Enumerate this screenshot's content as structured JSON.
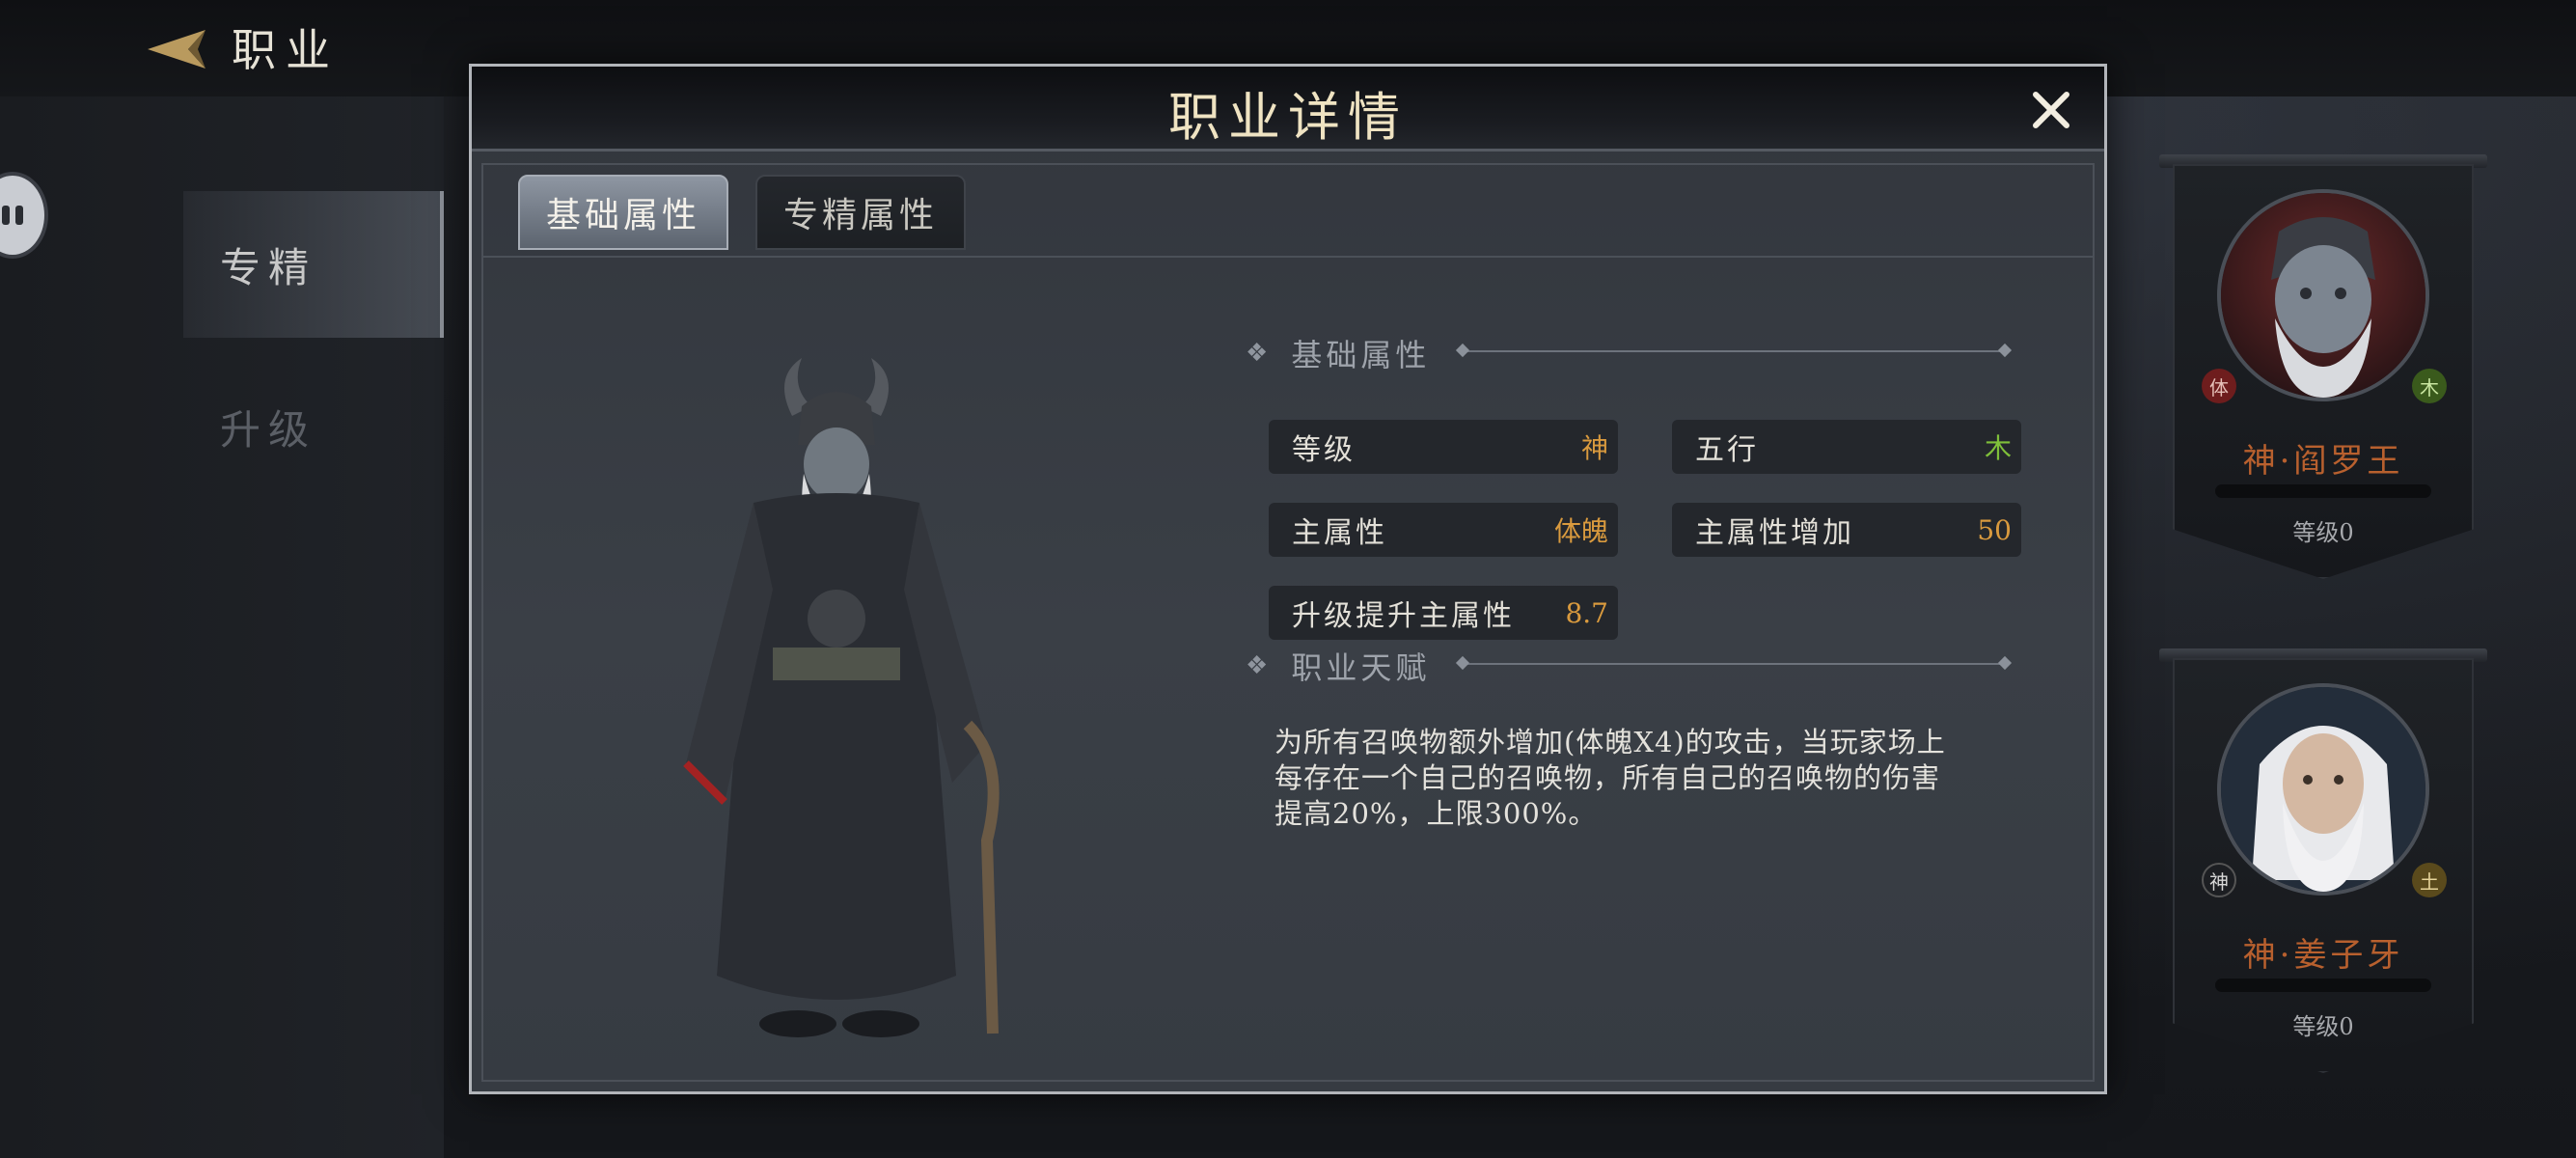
{
  "header": {
    "title": "职业"
  },
  "sidebar": {
    "items": [
      {
        "label": "专精"
      },
      {
        "label": "升级"
      }
    ]
  },
  "modal": {
    "title": "职业详情",
    "tabs": [
      {
        "label": "基础属性"
      },
      {
        "label": "专精属性"
      }
    ],
    "sections": {
      "basic": "基础属性",
      "talent": "职业天赋"
    },
    "attributes": [
      {
        "label": "等级",
        "value": "神",
        "color": "#d99a3e"
      },
      {
        "label": "五行",
        "value": "木",
        "color": "#7fbf3a"
      },
      {
        "label": "主属性",
        "value": "体魄",
        "color": "#d99a3e"
      },
      {
        "label": "主属性增加",
        "value": "50",
        "color": "#d99a3e"
      },
      {
        "label": "升级提升主属性",
        "value": "8.7",
        "color": "#d99a3e"
      }
    ],
    "talent_lines": [
      "为所有召唤物额外增加(体魄X4)的攻击，当玩家场上",
      "每存在一个自己的召唤物，所有自己的召唤物的伤害",
      "提高20%，上限300%。"
    ]
  },
  "heroes": [
    {
      "name": "神·阎罗王",
      "level": "等级0",
      "elem_left": "体",
      "elem_right": "木"
    },
    {
      "name": "神·姜子牙",
      "level": "等级0",
      "elem_left": "神",
      "elem_right": "土"
    }
  ],
  "colors": {
    "accent_gold": "#d99a3e",
    "wood_green": "#7fbf3a",
    "hero_name": "#b8602e"
  }
}
